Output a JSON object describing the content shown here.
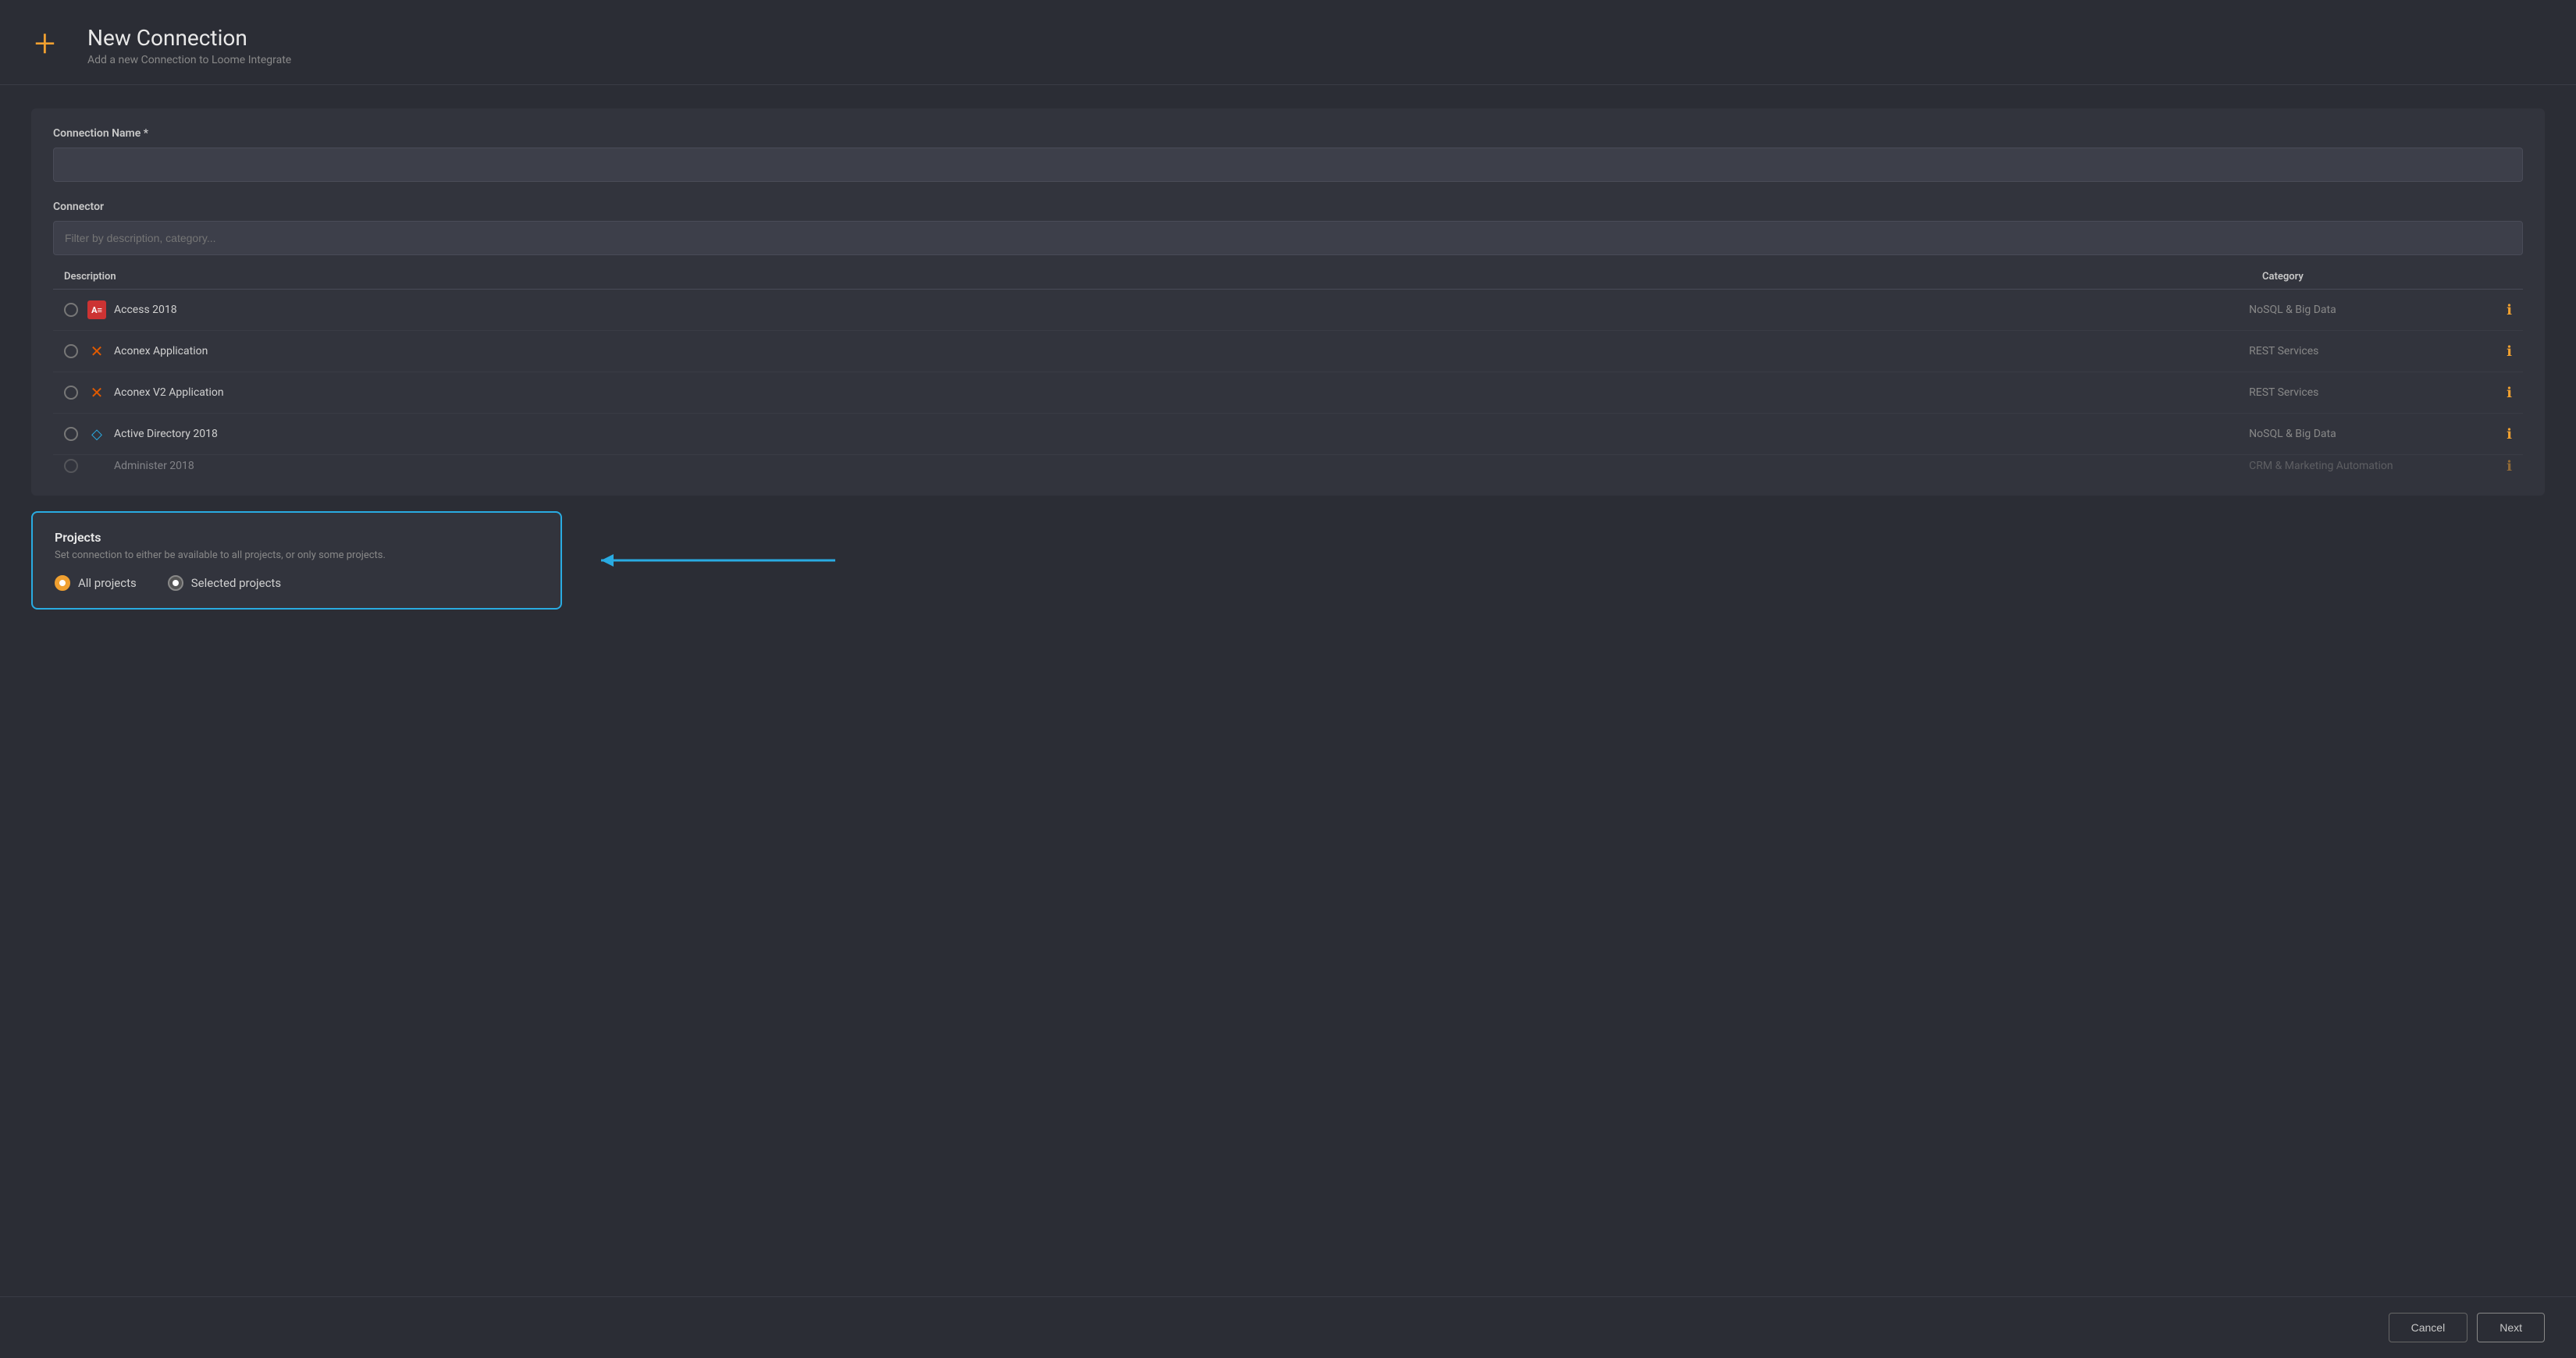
{
  "header": {
    "icon": "+",
    "title": "New Connection",
    "subtitle": "Add a new Connection to Loome Integrate"
  },
  "form": {
    "connection_name_label": "Connection Name *",
    "connection_name_placeholder": "",
    "connector_label": "Connector",
    "filter_placeholder": "Filter by description, category...",
    "table_headers": {
      "description": "Description",
      "category": "Category"
    }
  },
  "connectors": [
    {
      "name": "Access 2018",
      "category": "NoSQL & Big Data",
      "icon_type": "access",
      "selected": false
    },
    {
      "name": "Aconex Application",
      "category": "REST Services",
      "icon_type": "aconex",
      "selected": false
    },
    {
      "name": "Aconex V2 Application",
      "category": "REST Services",
      "icon_type": "aconex",
      "selected": false
    },
    {
      "name": "Active Directory 2018",
      "category": "NoSQL & Big Data",
      "icon_type": "active-dir",
      "selected": false
    },
    {
      "name": "Administer 2018",
      "category": "CRM & Marketing Automation",
      "icon_type": "other",
      "selected": false,
      "partial": true
    }
  ],
  "projects": {
    "title": "Projects",
    "subtitle": "Set connection to either be available to all projects, or only some projects.",
    "options": [
      {
        "label": "All projects",
        "selected": true
      },
      {
        "label": "Selected projects",
        "selected": false
      }
    ]
  },
  "footer": {
    "cancel_label": "Cancel",
    "next_label": "Next"
  }
}
